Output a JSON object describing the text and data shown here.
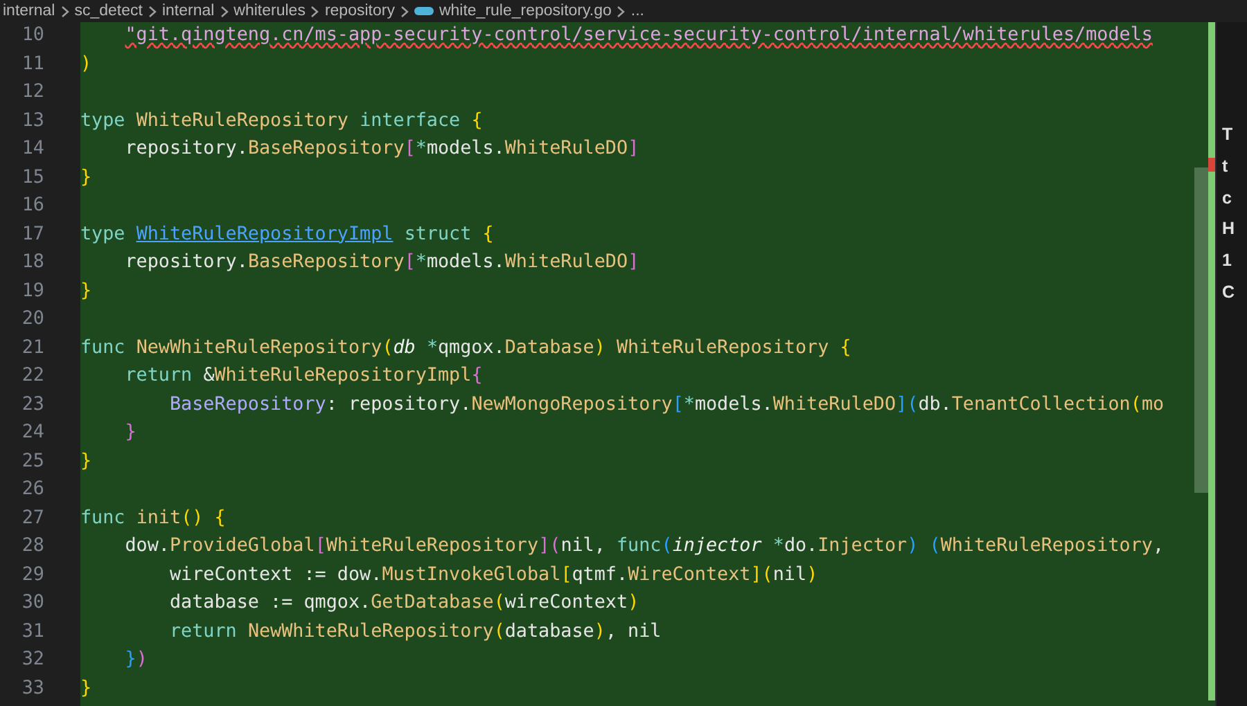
{
  "breadcrumb": [
    {
      "text": "internal",
      "kind": "folder"
    },
    {
      "text": "sc_detect",
      "kind": "folder"
    },
    {
      "text": "internal",
      "kind": "folder"
    },
    {
      "text": "whiterules",
      "kind": "folder"
    },
    {
      "text": "repository",
      "kind": "folder"
    },
    {
      "text": "white_rule_repository.go",
      "kind": "file"
    },
    {
      "text": "...",
      "kind": "more"
    }
  ],
  "editor": {
    "lines": [
      {
        "number": "10",
        "tokens": [
          {
            "kind": "err",
            "text": "    \"git.qingteng.cn/ms-app-security-control/service-security-control/internal/whiterules/models"
          }
        ]
      },
      {
        "number": "11",
        "tokens": [
          {
            "kind": "b1",
            "text": ")"
          }
        ]
      },
      {
        "number": "12"
      },
      {
        "number": "13",
        "tokens": [
          {
            "kind": "kw",
            "text": "type"
          },
          {
            "kind": "type",
            "text": " WhiteRuleRepository"
          },
          {
            "kind": "kw",
            "text": " interface"
          },
          {
            "kind": "b1",
            "text": " {"
          }
        ]
      },
      {
        "number": "14",
        "tokens": [
          {
            "kind": "plain",
            "text": "    repository."
          },
          {
            "kind": "type",
            "text": "BaseRepository"
          },
          {
            "kind": "b2",
            "text": "["
          },
          {
            "kind": "op",
            "text": "*"
          },
          {
            "kind": "plain",
            "text": "models."
          },
          {
            "kind": "type",
            "text": "WhiteRuleDO"
          },
          {
            "kind": "b2",
            "text": "]"
          }
        ]
      },
      {
        "number": "15",
        "tokens": [
          {
            "kind": "b1",
            "text": "}"
          }
        ]
      },
      {
        "number": "16"
      },
      {
        "number": "17",
        "tokens": [
          {
            "kind": "kw",
            "text": "type"
          },
          {
            "kind": "link",
            "text": " WhiteRuleRepositoryImpl"
          },
          {
            "kind": "kw",
            "text": " struct"
          },
          {
            "kind": "b1",
            "text": " {"
          }
        ]
      },
      {
        "number": "18",
        "tokens": [
          {
            "kind": "plain",
            "text": "    repository."
          },
          {
            "kind": "type",
            "text": "BaseRepository"
          },
          {
            "kind": "b2",
            "text": "["
          },
          {
            "kind": "op",
            "text": "*"
          },
          {
            "kind": "plain",
            "text": "models."
          },
          {
            "kind": "type",
            "text": "WhiteRuleDO"
          },
          {
            "kind": "b2",
            "text": "]"
          }
        ]
      },
      {
        "number": "19",
        "tokens": [
          {
            "kind": "b1",
            "text": "}"
          }
        ]
      },
      {
        "number": "20"
      },
      {
        "number": "21",
        "tokens": [
          {
            "kind": "kw",
            "text": "func"
          },
          {
            "kind": "fn",
            "text": " NewWhiteRuleRepository"
          },
          {
            "kind": "b1",
            "text": "("
          },
          {
            "kind": "param",
            "text": "db"
          },
          {
            "kind": "op",
            "text": " *"
          },
          {
            "kind": "plain",
            "text": "qmgox."
          },
          {
            "kind": "type",
            "text": "Database"
          },
          {
            "kind": "b1",
            "text": ")"
          },
          {
            "kind": "type",
            "text": " WhiteRuleRepository"
          },
          {
            "kind": "b1",
            "text": " {"
          }
        ]
      },
      {
        "number": "22",
        "tokens": [
          {
            "kind": "kw",
            "text": "    return"
          },
          {
            "kind": "plain",
            "text": " &"
          },
          {
            "kind": "type",
            "text": "WhiteRuleRepositoryImpl"
          },
          {
            "kind": "b2",
            "text": "{"
          }
        ]
      },
      {
        "number": "23",
        "tokens": [
          {
            "kind": "field",
            "text": "        BaseRepository"
          },
          {
            "kind": "plain",
            "text": ": repository."
          },
          {
            "kind": "fn",
            "text": "NewMongoRepository"
          },
          {
            "kind": "b3",
            "text": "["
          },
          {
            "kind": "op",
            "text": "*"
          },
          {
            "kind": "plain",
            "text": "models."
          },
          {
            "kind": "type",
            "text": "WhiteRuleDO"
          },
          {
            "kind": "b3",
            "text": "]("
          },
          {
            "kind": "plain",
            "text": "db."
          },
          {
            "kind": "fn",
            "text": "TenantCollection"
          },
          {
            "kind": "b1",
            "text": "("
          },
          {
            "kind": "type",
            "text": "mo"
          }
        ]
      },
      {
        "number": "24",
        "tokens": [
          {
            "kind": "b2",
            "text": "    }"
          }
        ]
      },
      {
        "number": "25",
        "tokens": [
          {
            "kind": "b1",
            "text": "}"
          }
        ]
      },
      {
        "number": "26"
      },
      {
        "number": "27",
        "tokens": [
          {
            "kind": "kw",
            "text": "func"
          },
          {
            "kind": "fn",
            "text": " init"
          },
          {
            "kind": "b1",
            "text": "()"
          },
          {
            "kind": "b1",
            "text": " {"
          }
        ]
      },
      {
        "number": "28",
        "tokens": [
          {
            "kind": "plain",
            "text": "    dow."
          },
          {
            "kind": "fn",
            "text": "ProvideGlobal"
          },
          {
            "kind": "b2",
            "text": "["
          },
          {
            "kind": "type",
            "text": "WhiteRuleRepository"
          },
          {
            "kind": "b2",
            "text": "]("
          },
          {
            "kind": "plain",
            "text": "nil,"
          },
          {
            "kind": "kw",
            "text": " func"
          },
          {
            "kind": "b3",
            "text": "("
          },
          {
            "kind": "param",
            "text": "injector"
          },
          {
            "kind": "op",
            "text": " *"
          },
          {
            "kind": "plain",
            "text": "do."
          },
          {
            "kind": "type",
            "text": "Injector"
          },
          {
            "kind": "b3",
            "text": ")"
          },
          {
            "kind": "b3",
            "text": " ("
          },
          {
            "kind": "type",
            "text": "WhiteRuleRepository"
          },
          {
            "kind": "plain",
            "text": ","
          }
        ]
      },
      {
        "number": "29",
        "tokens": [
          {
            "kind": "plain",
            "text": "        wireContext := dow."
          },
          {
            "kind": "fn",
            "text": "MustInvokeGlobal"
          },
          {
            "kind": "b1",
            "text": "["
          },
          {
            "kind": "plain",
            "text": "qtmf."
          },
          {
            "kind": "type",
            "text": "WireContext"
          },
          {
            "kind": "b1",
            "text": "]("
          },
          {
            "kind": "plain",
            "text": "nil"
          },
          {
            "kind": "b1",
            "text": ")"
          }
        ]
      },
      {
        "number": "30",
        "tokens": [
          {
            "kind": "plain",
            "text": "        database := qmgox."
          },
          {
            "kind": "fn",
            "text": "GetDatabase"
          },
          {
            "kind": "b1",
            "text": "("
          },
          {
            "kind": "plain",
            "text": "wireContext"
          },
          {
            "kind": "b1",
            "text": ")"
          }
        ]
      },
      {
        "number": "31",
        "tokens": [
          {
            "kind": "kw",
            "text": "        return"
          },
          {
            "kind": "fn",
            "text": " NewWhiteRuleRepository"
          },
          {
            "kind": "b1",
            "text": "("
          },
          {
            "kind": "plain",
            "text": "database"
          },
          {
            "kind": "b1",
            "text": ")"
          },
          {
            "kind": "plain",
            "text": ", nil"
          }
        ]
      },
      {
        "number": "32",
        "tokens": [
          {
            "kind": "b3",
            "text": "    }"
          },
          {
            "kind": "b2",
            "text": ")"
          }
        ]
      },
      {
        "number": "33",
        "tokens": [
          {
            "kind": "b1",
            "text": "}"
          }
        ]
      }
    ]
  },
  "side_panel": {
    "fragments": [
      "T",
      "t",
      "c",
      "H",
      "1",
      "C"
    ]
  }
}
